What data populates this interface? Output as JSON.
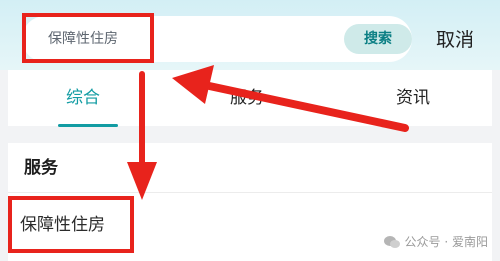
{
  "search": {
    "value": "保障性住房",
    "button_label": "搜索",
    "cancel_label": "取消"
  },
  "tabs": [
    {
      "label": "综合",
      "active": true
    },
    {
      "label": "服务",
      "active": false
    },
    {
      "label": "资讯",
      "active": false
    }
  ],
  "results": {
    "section_heading": "服务",
    "items": [
      {
        "label": "保障性住房"
      }
    ]
  },
  "watermark": {
    "text": "公众号 · 爱南阳",
    "icon": "wechat-icon"
  },
  "colors": {
    "accent": "#129ca3",
    "annotation": "#e8231c",
    "search_button_bg": "#cfeae9"
  }
}
